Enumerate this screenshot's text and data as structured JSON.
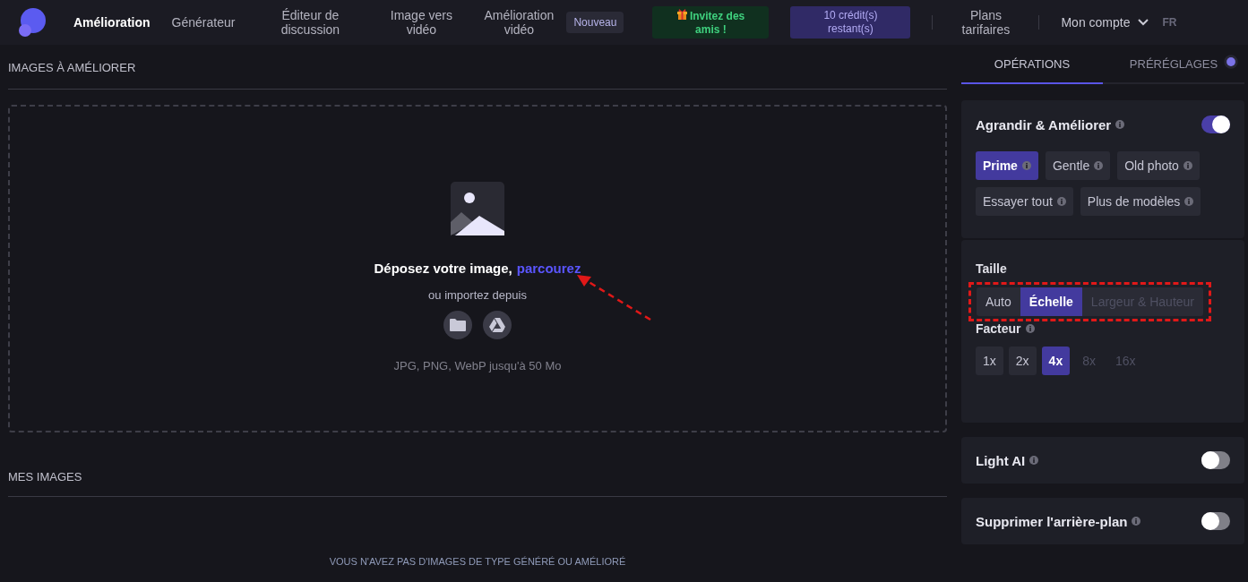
{
  "nav": {
    "items": [
      {
        "label": "Amélioration",
        "selected": true
      },
      {
        "label": "Générateur",
        "selected": false
      },
      {
        "label": "Éditeur de discussion",
        "selected": false
      },
      {
        "label": "Image vers vidéo",
        "selected": false
      },
      {
        "label": "Amélioration vidéo",
        "selected": false
      }
    ],
    "badge": "Nouveau",
    "invite": "Invitez des amis !",
    "credits": "10 crédit(s) restant(s)",
    "plans": "Plans tarifaires",
    "account": "Mon compte",
    "language": "FR"
  },
  "upload": {
    "title": "IMAGES À AMÉLIORER",
    "heading": "Déposez votre image,",
    "browse_link": "parcourez",
    "pointer_arrow": true,
    "import_label": "ou importez depuis",
    "formats": "JPG, PNG, WebP jusqu'à 50 Mo"
  },
  "my_images": {
    "title": "MES IMAGES",
    "empty_text": "VOUS N'AVEZ PAS D'IMAGES DE TYPE GÉNÉRÉ OU AMÉLIORÉ"
  },
  "panel": {
    "tabs": [
      {
        "label": "OPÉRATIONS",
        "selected": true,
        "dot": false
      },
      {
        "label": "PRÉRÉGLAGES",
        "selected": false,
        "dot": true
      }
    ],
    "upscale": {
      "title": "Agrandir & Améliorer",
      "on": true,
      "models": [
        {
          "label": "Prime",
          "selected": true
        },
        {
          "label": "Gentle",
          "selected": false
        },
        {
          "label": "Old photo",
          "selected": false
        },
        {
          "label": "Essayer tout",
          "selected": false
        },
        {
          "label": "Plus de modèles",
          "selected": false
        }
      ],
      "size_label": "Taille",
      "size_highlighted": true,
      "size_options": [
        {
          "label": "Auto",
          "selected": false,
          "disabled": false
        },
        {
          "label": "Échelle",
          "selected": true,
          "disabled": false
        },
        {
          "label": "Largeur & Hauteur",
          "selected": false,
          "disabled": true
        }
      ],
      "factor_label": "Facteur",
      "factors": [
        {
          "label": "1x",
          "selected": false,
          "disabled": false
        },
        {
          "label": "2x",
          "selected": false,
          "disabled": false
        },
        {
          "label": "4x",
          "selected": true,
          "disabled": false
        },
        {
          "label": "8x",
          "selected": false,
          "disabled": true
        },
        {
          "label": "16x",
          "selected": false,
          "disabled": true
        }
      ]
    },
    "toggles": [
      {
        "title": "Light AI",
        "on": false
      },
      {
        "title": "Supprimer l'arrière-plan",
        "on": false
      }
    ]
  }
}
